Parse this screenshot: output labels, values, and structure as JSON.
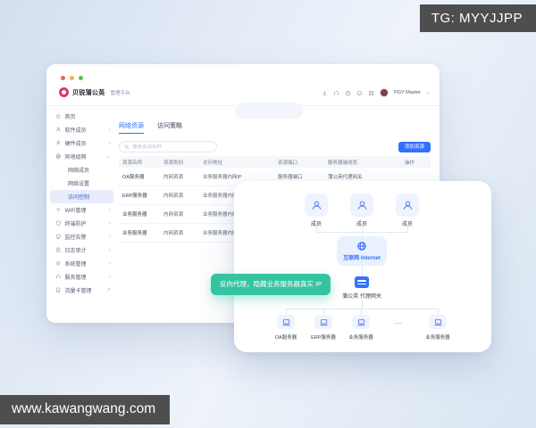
{
  "badges": {
    "tg": "TG: MYYJJPP",
    "site": "www.kawangwang.com"
  },
  "window": {
    "brand": {
      "name": "贝锐蒲公英",
      "product": "管理平台"
    },
    "header": {
      "account": "PGY Master"
    },
    "sidebar": {
      "items": [
        {
          "label": "首页"
        },
        {
          "label": "软件成员"
        },
        {
          "label": "硬件成员"
        },
        {
          "label": "异地组网"
        },
        {
          "label": "网络成员"
        },
        {
          "label": "网络设置"
        },
        {
          "label": "访问控制"
        },
        {
          "label": "WiFi管理"
        },
        {
          "label": "终端防护"
        },
        {
          "label": "监控告警"
        },
        {
          "label": "日志审计"
        },
        {
          "label": "系统管理"
        },
        {
          "label": "服务管理"
        },
        {
          "label": "流量卡管理"
        }
      ]
    },
    "content": {
      "tabs": [
        {
          "label": "网络资源"
        },
        {
          "label": "访问策略"
        }
      ],
      "search_placeholder": "搜索资源名称",
      "add_button": "添加资源",
      "table": {
        "headers": [
          "资源名称",
          "资源类别",
          "访问地址",
          "资源端口",
          "服务器端成员",
          "操作"
        ],
        "rows": [
          [
            "OA服务器",
            "内网资源",
            "业务服务器内网IP",
            "服务器端口",
            "蒲公英代理网关",
            ""
          ],
          [
            "ERP服务器",
            "内网资源",
            "业务服务器内网IP",
            "",
            "",
            ""
          ],
          [
            "业务服务器",
            "内网资源",
            "业务服务器内网IP",
            "",
            "",
            ""
          ],
          [
            "业务服务器",
            "内网资源",
            "业务服务器内网IP",
            "",
            "",
            ""
          ]
        ]
      }
    }
  },
  "diagram": {
    "members": [
      "成员",
      "成员",
      "成员"
    ],
    "internet": "互联网 Internet",
    "gateway": "蒲公英 代理网关",
    "badge": "反向代理，隐藏业务服务器真实 IP",
    "servers": [
      "OA服务器",
      "ERP服务器",
      "业务服务器",
      "业务服务器"
    ],
    "ellipsis": "—"
  },
  "icons": {
    "chevron_right": "›",
    "chevron_down": "⌄",
    "external": "↗",
    "caret": "⌄"
  },
  "colors": {
    "accent": "#3370ff",
    "badge_green": "#35c4a2",
    "badge_gray": "#4e4e4e",
    "logo_red": "#e2355f"
  }
}
